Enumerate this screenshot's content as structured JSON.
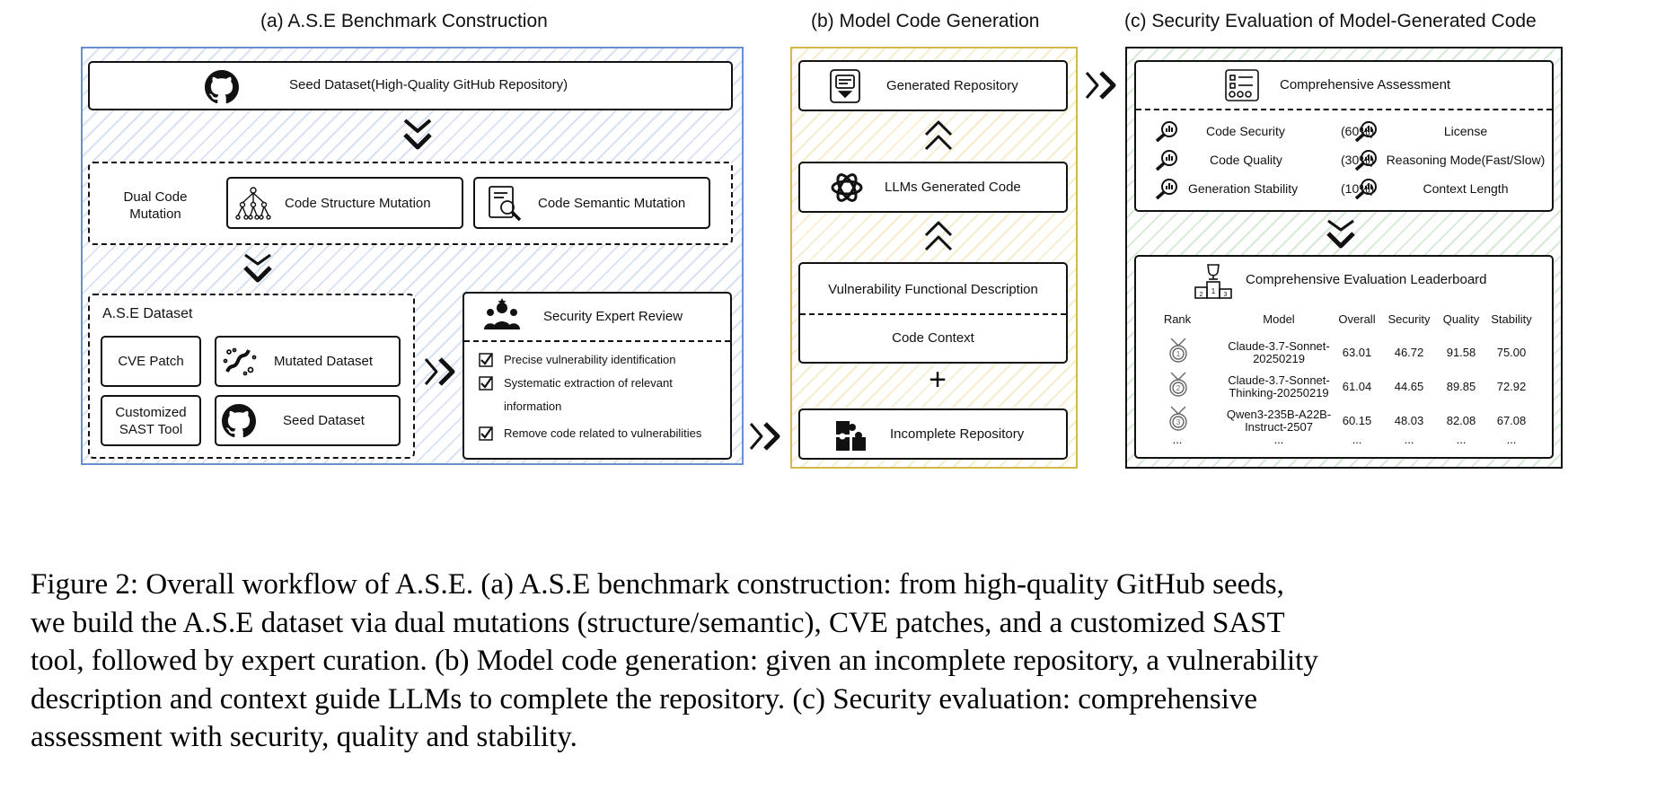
{
  "panels": {
    "a": {
      "title": "(a) A.S.E Benchmark Construction",
      "seed_box": "Seed Dataset(High-Quality GitHub Repository)",
      "dual_label_1": "Dual Code",
      "dual_label_2": "Mutation",
      "structure_mutation": "Code Structure Mutation",
      "semantic_mutation": "Code Semantic Mutation",
      "dataset_title": "A.S.E Dataset",
      "cve_patch": "CVE Patch",
      "mutated_dataset": "Mutated Dataset",
      "sast_1": "Customized",
      "sast_2": "SAST Tool",
      "seed_dataset": "Seed Dataset",
      "review_title": "Security Expert Review",
      "review_items": [
        "Precise vulnerability identification",
        "Systematic extraction of relevant",
        "information",
        "Remove code related to vulnerabilities"
      ]
    },
    "b": {
      "title": "(b) Model Code Generation",
      "generated_repo": "Generated Repository",
      "llm_code": "LLMs Generated Code",
      "vuln_desc": "Vulnerability Functional Description",
      "code_context": "Code Context",
      "plus": "+",
      "incomplete_repo": "Incomplete Repository"
    },
    "c": {
      "title": "(c) Security Evaluation of Model-Generated Code",
      "assessment_title": "Comprehensive Assessment",
      "metrics": [
        {
          "name": "Code Security",
          "weight": "(60%)",
          "factor": "License"
        },
        {
          "name": "Code Quality",
          "weight": "(30%)",
          "factor": "Reasoning Mode(Fast/Slow)"
        },
        {
          "name": "Generation Stability",
          "weight": "(10%)",
          "factor": "Context Length"
        }
      ],
      "leaderboard_title": "Comprehensive Evaluation Leaderboard",
      "columns": [
        "Rank",
        "Model",
        "Overall",
        "Security",
        "Quality",
        "Stability"
      ],
      "rows": [
        {
          "rank": "1",
          "model_1": "Claude-3.7-Sonnet-",
          "model_2": "20250219",
          "overall": "63.01",
          "security": "46.72",
          "quality": "91.58",
          "stability": "75.00"
        },
        {
          "rank": "2",
          "model_1": "Claude-3.7-Sonnet-",
          "model_2": "Thinking-20250219",
          "overall": "61.04",
          "security": "44.65",
          "quality": "89.85",
          "stability": "72.92"
        },
        {
          "rank": "3",
          "model_1": "Qwen3-235B-A22B-",
          "model_2": "Instruct-2507",
          "overall": "60.15",
          "security": "48.03",
          "quality": "82.08",
          "stability": "67.08"
        }
      ],
      "ellipsis": "..."
    }
  },
  "caption_lines": [
    "Figure 2: Overall workflow of A.S.E. (a) A.S.E benchmark construction: from high-quality GitHub seeds,",
    "we build the A.S.E dataset via dual mutations (structure/semantic), CVE patches, and a customized SAST",
    "tool, followed by expert curation. (b) Model code generation: given an incomplete repository, a vulnerability",
    "description and context guide LLMs to complete the repository. (c) Security evaluation: comprehensive",
    "assessment with security, quality and stability."
  ],
  "colors": {
    "panel_a_border": "#6a8fd0",
    "panel_b_border": "#d4b94a",
    "panel_c_border": "#111111"
  },
  "icons": [
    "github-icon",
    "network-tree-icon",
    "document-search-icon",
    "bacteria-icon",
    "experts-icon",
    "checkbox-icon",
    "repository-icon",
    "openai-icon",
    "puzzle-icon",
    "checklist-icon",
    "magnifier-chart-icon",
    "podium-icon",
    "medal-icon",
    "double-chevron-down-icon",
    "double-chevron-up-icon",
    "double-chevron-right-icon"
  ]
}
